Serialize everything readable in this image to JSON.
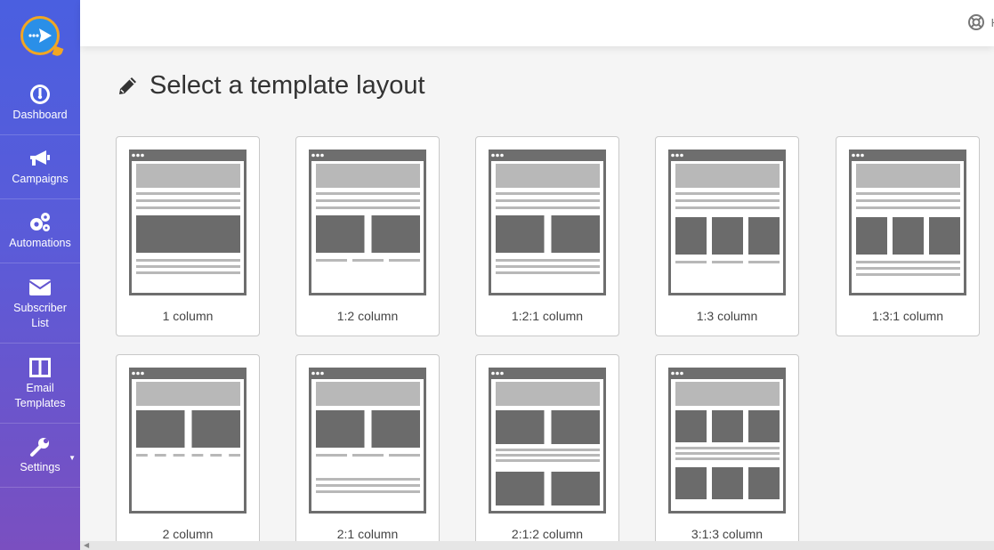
{
  "sidebar": {
    "items": [
      {
        "label": "Dashboard",
        "icon": "dashboard-icon"
      },
      {
        "label": "Campaigns",
        "icon": "megaphone-icon"
      },
      {
        "label": "Automations",
        "icon": "gears-icon"
      },
      {
        "label": "Subscriber\nList",
        "icon": "envelope-icon"
      },
      {
        "label": "Email\nTemplates",
        "icon": "columns-icon"
      },
      {
        "label": "Settings",
        "icon": "wrench-icon"
      }
    ]
  },
  "topbar": {
    "help_label": "H"
  },
  "page": {
    "title": "Select a template layout"
  },
  "layouts": [
    {
      "label": "1 column",
      "type": "1"
    },
    {
      "label": "1:2 column",
      "type": "1:2"
    },
    {
      "label": "1:2:1 column",
      "type": "1:2:1"
    },
    {
      "label": "1:3 column",
      "type": "1:3"
    },
    {
      "label": "1:3:1 column",
      "type": "1:3:1"
    },
    {
      "label": "2 column",
      "type": "2"
    },
    {
      "label": "2:1 column",
      "type": "2:1"
    },
    {
      "label": "2:1:2 column",
      "type": "2:1:2"
    },
    {
      "label": "3:1:3 column",
      "type": "3:1:3"
    }
  ],
  "colors": {
    "sidebar_top": "#4a5fe0",
    "sidebar_bottom": "#7a4fc0",
    "block_dark": "#6b6b6b",
    "block_light": "#b8b8b8"
  }
}
